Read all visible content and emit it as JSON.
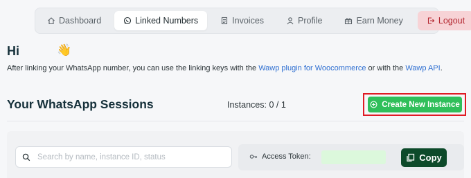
{
  "nav": {
    "tabs": [
      {
        "label": "Dashboard",
        "icon": "home-icon"
      },
      {
        "label": "Linked Numbers",
        "icon": "whatsapp-icon",
        "active": true
      },
      {
        "label": "Invoices",
        "icon": "invoice-icon"
      },
      {
        "label": "Profile",
        "icon": "user-icon"
      },
      {
        "label": "Earn Money",
        "icon": "gift-icon"
      },
      {
        "label": "Logout",
        "icon": "logout-icon",
        "color": "#b3262f"
      }
    ]
  },
  "greeting": {
    "text": "Hi",
    "emoji": "👋"
  },
  "intro": {
    "before": "After linking your WhatsApp number, you can use the linking keys with the ",
    "link1": "Wawp plugin for Woocommerce",
    "middle": " or with the ",
    "link2": "Wawp API",
    "after": "."
  },
  "sessions": {
    "title": "Your WhatsApp Sessions",
    "instances": "Instances: 0 / 1",
    "create_label": "Create New Instance"
  },
  "search": {
    "placeholder": "Search by name, instance ID, status",
    "value": ""
  },
  "token": {
    "label": "Access Token:",
    "value": ""
  },
  "copy": {
    "label": "Copy"
  },
  "colors": {
    "accent_green": "#2fbf5a",
    "dark_green": "#0d4a2a",
    "link_blue": "#2f6fd1",
    "highlight_red": "#e01b24",
    "logout_bg": "#f7d3d6"
  }
}
